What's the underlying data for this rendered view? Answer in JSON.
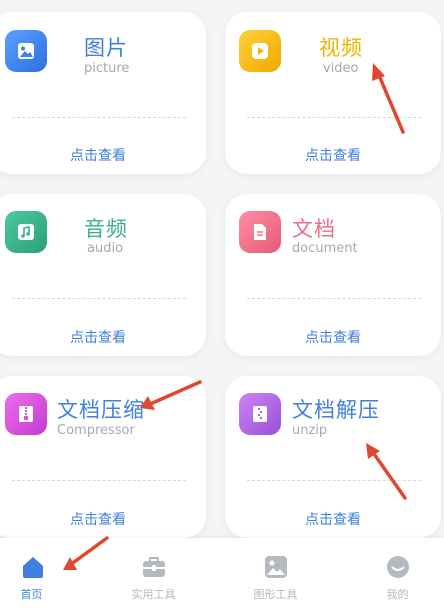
{
  "cards": [
    {
      "title": "图片",
      "subtitle": "picture",
      "link": "点击查看",
      "icon": "picture-icon",
      "color": "#3b82e8",
      "title_color": "#3f7fdf"
    },
    {
      "title": "视频",
      "subtitle": "video",
      "link": "点击查看",
      "icon": "video-icon",
      "color": "#f2b705",
      "title_color": "#f0b400"
    },
    {
      "title": "音频",
      "subtitle": "audio",
      "link": "点击查看",
      "icon": "music-icon",
      "color": "#36b58e",
      "title_color": "#3bb08d"
    },
    {
      "title": "文档",
      "subtitle": "document",
      "link": "点击查看",
      "icon": "document-icon",
      "color": "#f0708a",
      "title_color": "#ec6f88"
    },
    {
      "title": "文档压缩",
      "subtitle": "Compressor",
      "link": "点击查看",
      "icon": "zip-icon",
      "color": "#d44fd6",
      "title_color": "#3f7fdf"
    },
    {
      "title": "文档解压",
      "subtitle": "unzip",
      "link": "点击查看",
      "icon": "unzip-icon",
      "color": "#b45fe0",
      "title_color": "#3f7fdf"
    }
  ],
  "nav": [
    {
      "label": "首页",
      "icon": "home-icon",
      "active": true
    },
    {
      "label": "实用工具",
      "icon": "toolbox-icon",
      "active": false
    },
    {
      "label": "图形工具",
      "icon": "image-tool-icon",
      "active": false
    },
    {
      "label": "我的",
      "icon": "profile-icon",
      "active": false
    }
  ],
  "colors": {
    "accent": "#3f7fdf",
    "arrow": "#e0472f",
    "inactive": "#b5b9c0"
  }
}
